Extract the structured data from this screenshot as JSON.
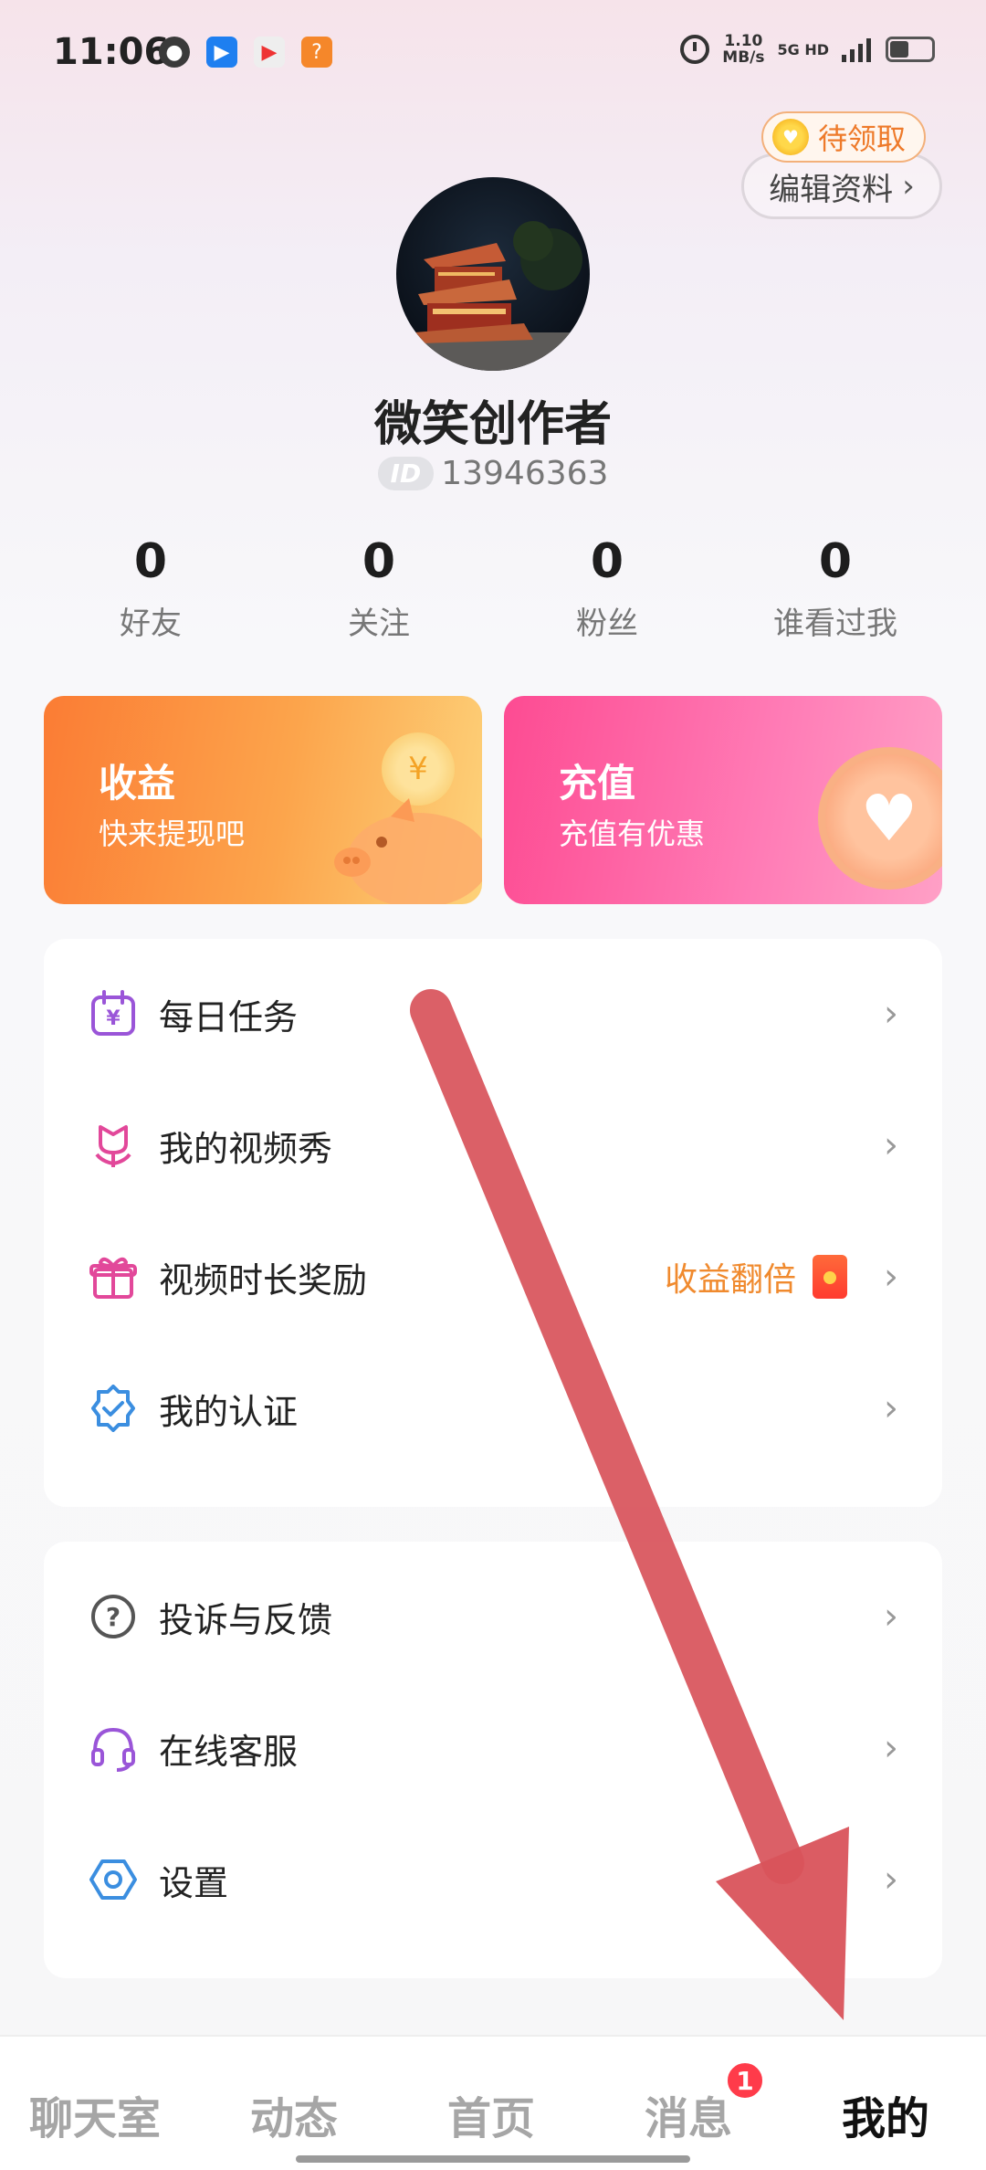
{
  "status_bar": {
    "time": "11:06",
    "speed_value": "1.10",
    "speed_unit": "MB/s",
    "network": "5G HD",
    "apps": [
      "wechat-icon",
      "app-blue-icon",
      "app-video-icon",
      "app-orange-icon"
    ]
  },
  "header": {
    "pending_label": "待领取",
    "edit_profile_label": "编辑资料",
    "chevron": "›"
  },
  "profile": {
    "username": "微笑创作者",
    "id_tag": "ID",
    "id_number": "13946363"
  },
  "stats": [
    {
      "value": "0",
      "label": "好友"
    },
    {
      "value": "0",
      "label": "关注"
    },
    {
      "value": "0",
      "label": "粉丝"
    },
    {
      "value": "0",
      "label": "谁看过我"
    }
  ],
  "cards": {
    "earnings": {
      "title": "收益",
      "subtitle": "快来提现吧",
      "coin_symbol": "¥"
    },
    "recharge": {
      "title": "充值",
      "subtitle": "充值有优惠",
      "heart_symbol": "♥"
    }
  },
  "menu_group_1": [
    {
      "label": "每日任务",
      "icon": "calendar-yuan-icon"
    },
    {
      "label": "我的视频秀",
      "icon": "flower-icon"
    },
    {
      "label": "视频时长奖励",
      "icon": "gift-icon",
      "extra": "收益翻倍"
    },
    {
      "label": "我的认证",
      "icon": "verified-badge-icon"
    }
  ],
  "menu_group_2": [
    {
      "label": "投诉与反馈",
      "icon": "question-circle-icon"
    },
    {
      "label": "在线客服",
      "icon": "headset-icon"
    },
    {
      "label": "设置",
      "icon": "settings-hexagon-icon"
    }
  ],
  "chevron": "›",
  "bottom_nav": {
    "items": [
      "聊天室",
      "动态",
      "首页",
      "消息",
      "我的"
    ],
    "message_badge": "1",
    "active": "我的"
  },
  "colors": {
    "earn_gradient_start": "#fb7c34",
    "recharge_gradient_start": "#fd4b92",
    "accent_orange": "#f08a2e",
    "badge_red": "#ff3b4a",
    "arrow_red": "#d9535b"
  }
}
